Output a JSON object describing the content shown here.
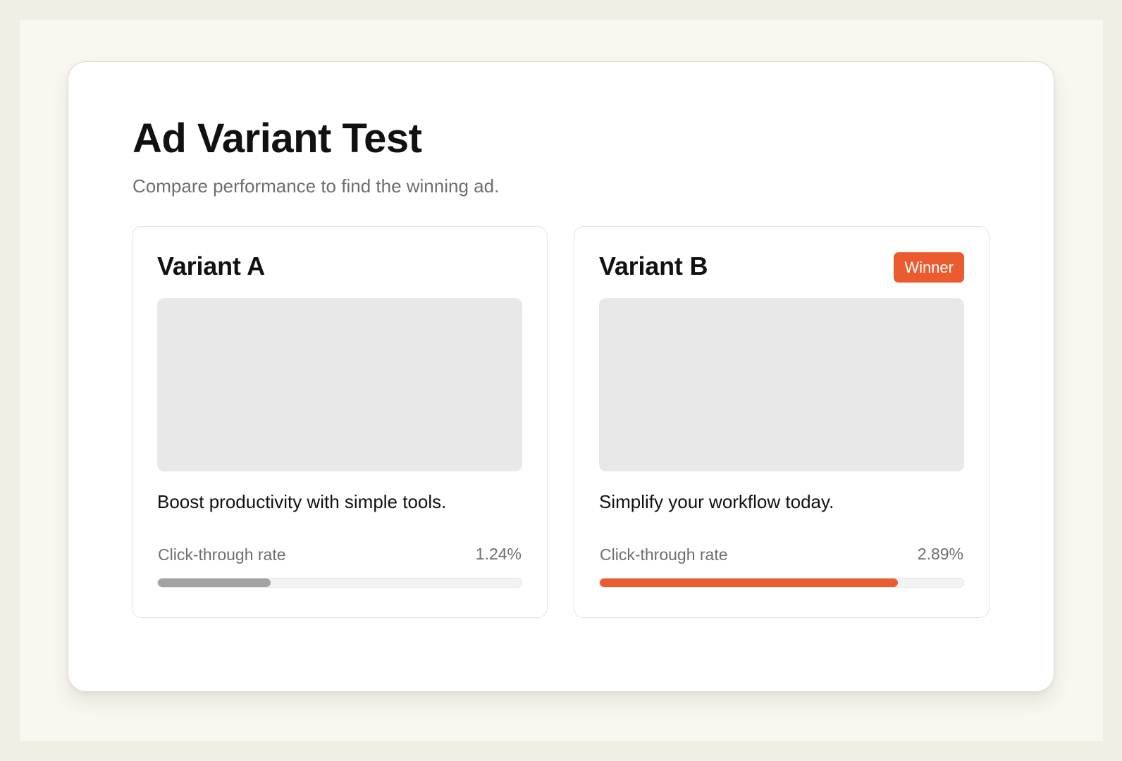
{
  "page": {
    "title": "Ad Variant Test",
    "subtitle": "Compare performance to find the winning ad."
  },
  "variants": [
    {
      "name": "Variant A",
      "ad_copy": "Boost productivity with simple tools.",
      "metric_label": "Click-through rate",
      "metric_value": "1.24%",
      "progress": 0.31,
      "bar_color": "#a3a3a6",
      "badge": ""
    },
    {
      "name": "Variant B",
      "ad_copy": "Simplify your workflow today.",
      "metric_label": "Click-through rate",
      "metric_value": "2.89%",
      "progress": 0.82,
      "bar_color": "#ec5b2f",
      "badge": "Winner"
    }
  ],
  "colors": {
    "accent": "#ec5b2f",
    "neutral_bar": "#a3a3a6",
    "preview_placeholder": "#e8e8e9",
    "background": "#f1eee4"
  }
}
